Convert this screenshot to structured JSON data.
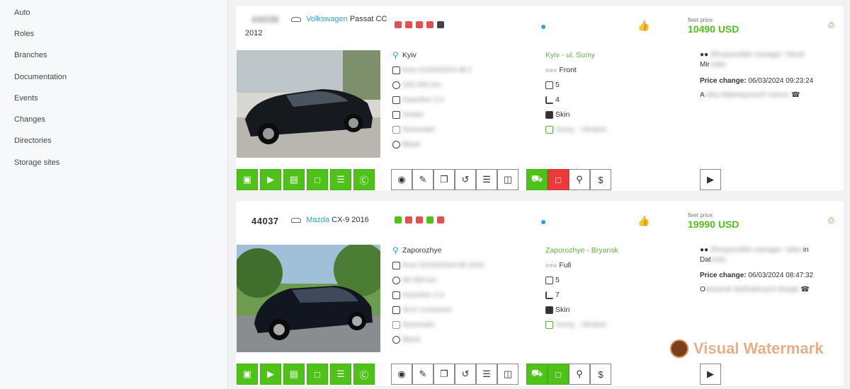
{
  "sidebar": {
    "items": [
      {
        "label": "Auto"
      },
      {
        "label": "Roles"
      },
      {
        "label": "Branches"
      },
      {
        "label": "Documentation"
      },
      {
        "label": "Events"
      },
      {
        "label": "Changes"
      },
      {
        "label": "Directories"
      },
      {
        "label": "Storage sites"
      }
    ]
  },
  "cards": [
    {
      "lot_id": "44038",
      "make": "Volkswagen",
      "model": "Passat CC",
      "year": "2012",
      "location": "Kyiv",
      "date_blurred": "from 01/03/2024 till 2",
      "mileage_blurred": "250 000 km",
      "engine_blurred": "Gasoline 2.0",
      "body_blurred": "Sedan",
      "gearbox_blurred": "Automatic",
      "color_blurred": "Black",
      "route": "Kyiv - ul. Sumy",
      "drive": "Front",
      "doors": "5",
      "seats": "4",
      "interior": "Skin",
      "customs_blurred": "Sumy · Ukraine",
      "price_label": "fleet price:",
      "price": "10490 USD",
      "manager_blurred": "(Responsible manager: Sitzuk",
      "manager_tail": "Mir",
      "price_change_label": "Price change:",
      "price_change": "06/03/2024 09:23:24",
      "contact_head": "A",
      "contact_blurred": "ndriy Mykolayovych Ivanov"
    },
    {
      "lot_id": "44037",
      "make": "Mazda",
      "model": "CX-9 2016",
      "year": "",
      "location": "Zaporozhye",
      "date_blurred": "from 01/03/2024 till 2024",
      "mileage_blurred": "98 000 km",
      "engine_blurred": "Gasoline 2.5",
      "body_blurred": "SUV crossover",
      "gearbox_blurred": "Automatic",
      "color_blurred": "Black",
      "route": "Zaporozhye - Bryansk",
      "drive": "Full",
      "doors": "5",
      "seats": "7",
      "interior": "Skin",
      "customs_blurred": "Sumy · Ukraine",
      "price_label": "fleet price:",
      "price": "19990 USD",
      "manager_blurred": "(Responsible manager: Valen",
      "manager_tail": "in",
      "manager_line2": "Dat",
      "price_change_label": "Price change:",
      "price_change": "06/03/2024 08:47:32",
      "contact_head": "O",
      "contact_blurred": "leksandr Mykhailovych Burjak"
    }
  ],
  "watermark": {
    "text": "Visual Watermark"
  },
  "colors": {
    "accent_green": "#4fc21a",
    "link_blue": "#2aa3d8",
    "alert_red": "#ec3a3a"
  }
}
